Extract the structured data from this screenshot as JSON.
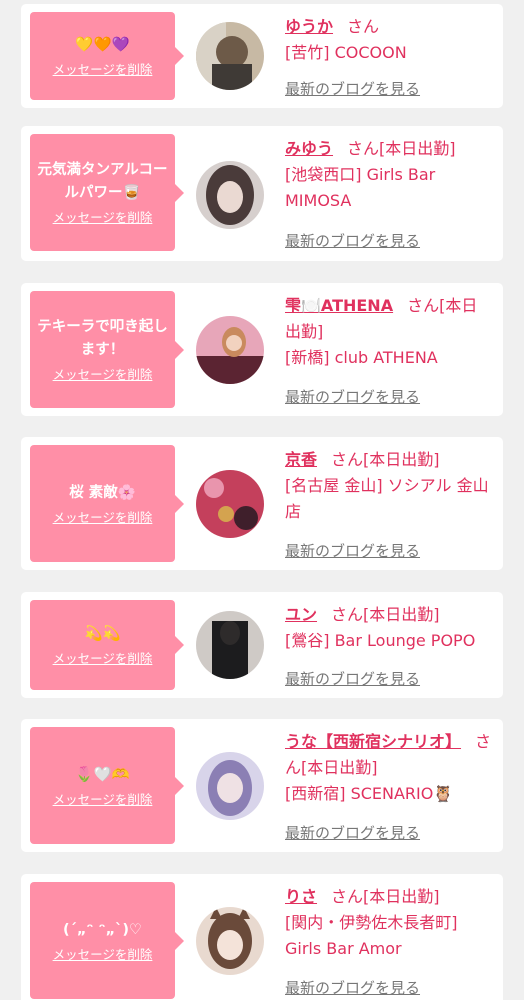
{
  "items": [
    {
      "message": "💛🧡💜",
      "delete_label": "メッセージを削除",
      "name": "ゆうか",
      "honorific": "さん",
      "status": "",
      "shop": "[苦竹] COCOON",
      "blog_label": "最新のブログを見る",
      "avatar_colors": [
        "#c7b9a4",
        "#6d5a48"
      ]
    },
    {
      "message": "元気満タンアルコールパワー🥃",
      "delete_label": "メッセージを削除",
      "name": "みゆう",
      "honorific": "さん",
      "status": "[本日出勤]",
      "shop": "[池袋西口] Girls Bar MIMOSA",
      "blog_label": "最新のブログを見る",
      "avatar_colors": [
        "#d6cfcd",
        "#4a3b3a"
      ]
    },
    {
      "message": "テキーラで叩き起します！",
      "delete_label": "メッセージを削除",
      "name": "雫🍽️ATHENA",
      "honorific": "さん",
      "status": "[本日出勤]",
      "shop": "[新橋] club ATHENA",
      "blog_label": "最新のブログを見る",
      "avatar_colors": [
        "#e7a6b9",
        "#5b2432"
      ]
    },
    {
      "message": "桜 素敵🌸",
      "delete_label": "メッセージを削除",
      "name": "京香",
      "honorific": "さん",
      "status": "[本日出勤]",
      "shop": "[名古屋 金山] ソシアル 金山店",
      "blog_label": "最新のブログを見る",
      "avatar_colors": [
        "#c4405c",
        "#3f1f2b"
      ]
    },
    {
      "message": "💫💫",
      "delete_label": "メッセージを削除",
      "name": "ユン",
      "honorific": "さん",
      "status": "[本日出勤]",
      "shop": "[鶯谷] Bar Lounge POPO",
      "blog_label": "最新のブログを見る",
      "avatar_colors": [
        "#cfcac6",
        "#1c1c1e"
      ]
    },
    {
      "message": "🌷🤍🫶",
      "delete_label": "メッセージを削除",
      "name": "うな【西新宿シナリオ】",
      "honorific": "さん",
      "status": "[本日出勤]",
      "shop": "[西新宿] SCENARIO🦉",
      "blog_label": "最新のブログを見る",
      "avatar_colors": [
        "#d8d4ea",
        "#8b7fb4"
      ]
    },
    {
      "message": "(´„ᵔ ᵔ„`)♡",
      "delete_label": "メッセージを削除",
      "name": "りさ",
      "honorific": "さん",
      "status": "[本日出勤]",
      "shop": "[関内・伊勢佐木長者町] Girls Bar Amor",
      "blog_label": "最新のブログを見る",
      "avatar_colors": [
        "#e8d9cf",
        "#6a4a3a"
      ]
    }
  ]
}
